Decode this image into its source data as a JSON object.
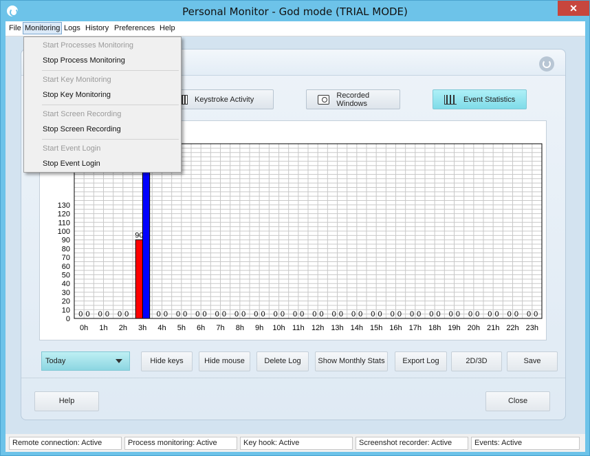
{
  "window": {
    "title": "Personal Monitor - God mode (TRIAL MODE)",
    "close_label": "✕"
  },
  "menubar": {
    "items": [
      "File",
      "Monitoring",
      "Logs",
      "History",
      "Preferences",
      "Help"
    ]
  },
  "monitoring_menu": {
    "items": [
      {
        "label": "Start Processes Monitoring",
        "enabled": false
      },
      {
        "label": "Stop Process Monitoring",
        "enabled": true
      },
      {
        "label": "Start Key Monitoring",
        "enabled": false
      },
      {
        "label": "Stop Key Monitoring",
        "enabled": true
      },
      {
        "label": "Start Screen Recording",
        "enabled": false
      },
      {
        "label": "Stop Screen Recording",
        "enabled": true
      },
      {
        "label": "Start Event Login",
        "enabled": false
      },
      {
        "label": "Stop Event Login",
        "enabled": true
      }
    ]
  },
  "tabs": [
    {
      "label": "Keystroke Activity",
      "icon": "keyboard-icon",
      "selected": false
    },
    {
      "label": "Recorded Windows",
      "icon": "camera-icon",
      "selected": false
    },
    {
      "label": "Event Statistics",
      "icon": "bar-chart-icon",
      "selected": true
    }
  ],
  "chart_data": {
    "type": "bar",
    "categories": [
      "0h",
      "1h",
      "2h",
      "3h",
      "4h",
      "5h",
      "6h",
      "7h",
      "8h",
      "9h",
      "10h",
      "11h",
      "12h",
      "13h",
      "14h",
      "15h",
      "16h",
      "17h",
      "18h",
      "19h",
      "20h",
      "21h",
      "22h",
      "23h"
    ],
    "series": [
      {
        "color": "#ff0000",
        "values": [
          0,
          0,
          0,
          90,
          0,
          0,
          0,
          0,
          0,
          0,
          0,
          0,
          0,
          0,
          0,
          0,
          0,
          0,
          0,
          0,
          0,
          0,
          0,
          0
        ]
      },
      {
        "color": "#0000ff",
        "values": [
          0,
          0,
          0,
          null,
          0,
          0,
          0,
          0,
          0,
          0,
          0,
          0,
          0,
          0,
          0,
          0,
          0,
          0,
          0,
          0,
          0,
          0,
          0,
          0
        ]
      }
    ],
    "ylim": [
      0,
      200
    ],
    "yticks": [
      0,
      10,
      20,
      30,
      40,
      50,
      60,
      70,
      80,
      90,
      100,
      110,
      120,
      130
    ],
    "grid": true
  },
  "controls": {
    "period_value": "Today",
    "buttons": [
      "Hide keys",
      "Hide mouse",
      "Delete Log",
      "Show Monthly Stats",
      "Export Log",
      "2D/3D",
      "Save"
    ]
  },
  "footer": {
    "help_label": "Help",
    "close_label": "Close"
  },
  "statusbar": [
    "Remote connection: Active",
    "Process monitoring: Active",
    "Key hook: Active",
    "Screenshot recorder: Active",
    "Events: Active"
  ],
  "colors": {
    "titlebar": "#6dc3e9",
    "accent_selected": "#8cd6e1",
    "bar_red": "#ff0000",
    "bar_blue": "#0000ff"
  }
}
